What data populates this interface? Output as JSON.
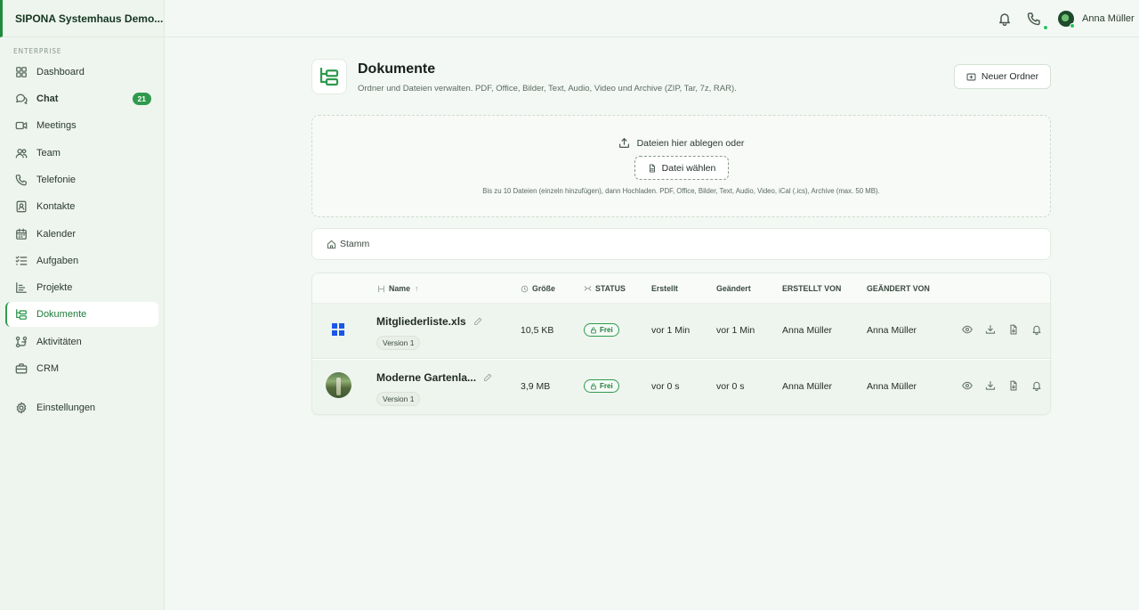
{
  "sidebar": {
    "brand": "SIPONA Systemhaus Demo...",
    "section": "ENTERPRISE",
    "items": [
      {
        "label": "Dashboard",
        "icon": "grid-icon"
      },
      {
        "label": "Chat",
        "icon": "chat-icon",
        "badge": "21"
      },
      {
        "label": "Meetings",
        "icon": "video-icon"
      },
      {
        "label": "Team",
        "icon": "users-icon"
      },
      {
        "label": "Telefonie",
        "icon": "phone-icon"
      },
      {
        "label": "Kontakte",
        "icon": "contact-icon"
      },
      {
        "label": "Kalender",
        "icon": "calendar-icon"
      },
      {
        "label": "Aufgaben",
        "icon": "tasks-icon"
      },
      {
        "label": "Projekte",
        "icon": "project-icon"
      },
      {
        "label": "Dokumente",
        "icon": "folder-tree-icon"
      },
      {
        "label": "Aktivitäten",
        "icon": "activity-icon"
      },
      {
        "label": "CRM",
        "icon": "briefcase-icon"
      },
      {
        "label": "Einstellungen",
        "icon": "gear-icon"
      }
    ]
  },
  "topbar": {
    "user_name": "Anna Müller"
  },
  "page": {
    "title": "Dokumente",
    "subtitle": "Ordner und Dateien verwalten. PDF, Office, Bilder, Text, Audio, Video und Archive (ZIP, Tar, 7z, RAR).",
    "new_folder_label": "Neuer Ordner"
  },
  "dropzone": {
    "text": "Dateien hier ablegen oder",
    "choose_label": "Datei wählen",
    "hint": "Bis zu 10 Dateien (einzeln hinzufügen), dann Hochladen. PDF, Office, Bilder, Text, Audio, Video, iCal (.ics), Archive (max. 50 MB)."
  },
  "breadcrumb": {
    "root": "Stamm"
  },
  "table": {
    "headers": {
      "name": "Name",
      "sort": "↑",
      "size": "Größe",
      "status": "STATUS",
      "created": "Erstellt",
      "changed": "Geändert",
      "created_by": "ERSTELLT VON",
      "changed_by": "GEÄNDERT VON"
    },
    "rows": [
      {
        "name": "Mitgliederliste.xls",
        "version": "Version 1",
        "size": "10,5 KB",
        "status": "Frei",
        "created": "vor 1 Min",
        "changed": "vor 1 Min",
        "created_by": "Anna Müller",
        "changed_by": "Anna Müller"
      },
      {
        "name": "Moderne Gartenla...",
        "version": "Version 1",
        "size": "3,9 MB",
        "status": "Frei",
        "created": "vor 0 s",
        "changed": "vor 0 s",
        "created_by": "Anna Müller",
        "changed_by": "Anna Müller"
      }
    ]
  },
  "colors": {
    "accent": "#2f9a4e",
    "sidebar_bg": "#eef5ee",
    "presence": "#22c55e",
    "excel_icon": "#1a56e8"
  }
}
